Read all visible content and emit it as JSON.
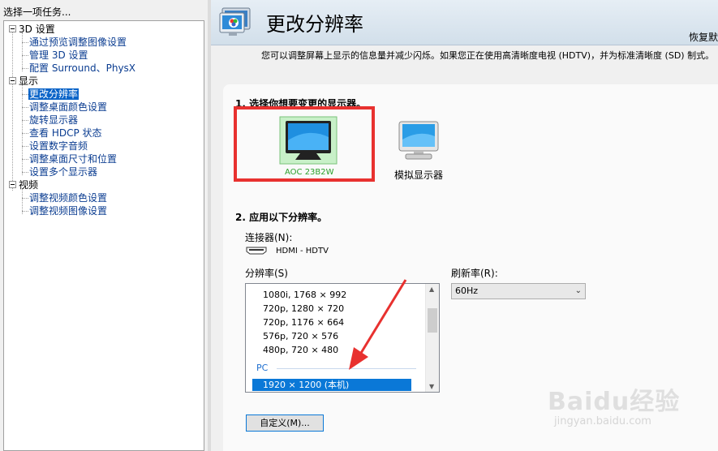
{
  "left": {
    "title": "选择一项任务...",
    "categories": [
      {
        "label": "3D 设置",
        "items": [
          "通过预览调整图像设置",
          "管理 3D 设置",
          "配置 Surround、PhysX"
        ]
      },
      {
        "label": "显示",
        "items": [
          "更改分辨率",
          "调整桌面颜色设置",
          "旋转显示器",
          "查看 HDCP 状态",
          "设置数字音频",
          "调整桌面尺寸和位置",
          "设置多个显示器"
        ]
      },
      {
        "label": "视频",
        "items": [
          "调整视频颜色设置",
          "调整视频图像设置"
        ]
      }
    ],
    "selected_item": "更改分辨率"
  },
  "header": {
    "title": "更改分辨率",
    "restore": "恢复默"
  },
  "description": "您可以调整屏幕上显示的信息量并减少闪烁。如果您正在使用高清晰度电视 (HDTV)，并为标准清晰度 (SD) 制式。",
  "section1": {
    "title": "1. 选择你想要变更的显示器。",
    "monitors": [
      {
        "label": "AOC 23B2W",
        "selected": true
      },
      {
        "label": "模拟显示器",
        "selected": false
      }
    ]
  },
  "section2": {
    "title": "2. 应用以下分辨率。",
    "connector_label": "连接器(N):",
    "connector_value": "HDMI - HDTV",
    "resolution_label": "分辨率(S)",
    "resolutions": [
      "1080i, 1768 × 992",
      "720p, 1280 × 720",
      "720p, 1176 × 664",
      "576p, 720 × 576",
      "480p, 720 × 480"
    ],
    "group_pc": "PC",
    "selected_resolution": "1920 × 1200 (本机)",
    "refresh_label": "刷新率(R):",
    "refresh_value": "60Hz",
    "custom_button": "自定义(M)..."
  },
  "watermark": {
    "main": "Baidu经验",
    "sub": "jingyan.baidu.com"
  },
  "colors": {
    "highlight_border": "#e8312f",
    "selection": "#0a78d7",
    "link": "#0b3d91",
    "pc_group": "#1e6fd0"
  }
}
